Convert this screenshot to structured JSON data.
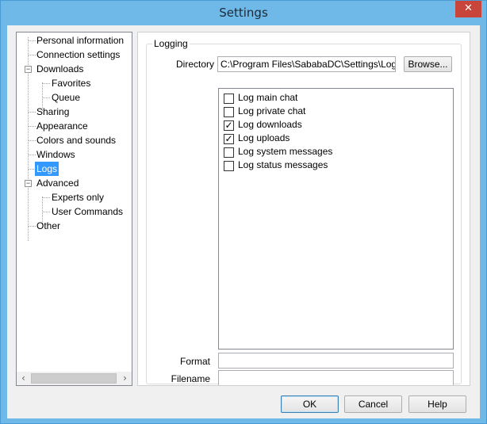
{
  "window": {
    "title": "Settings",
    "close_glyph": "✕"
  },
  "tree": {
    "items": [
      {
        "label": "Personal information"
      },
      {
        "label": "Connection settings"
      },
      {
        "label": "Downloads",
        "expander": "−"
      },
      {
        "label": "Favorites"
      },
      {
        "label": "Queue"
      },
      {
        "label": "Sharing"
      },
      {
        "label": "Appearance"
      },
      {
        "label": "Colors and sounds"
      },
      {
        "label": "Windows"
      },
      {
        "label": "Logs",
        "selected": true
      },
      {
        "label": "Advanced",
        "expander": "−"
      },
      {
        "label": "Experts only"
      },
      {
        "label": "User Commands"
      },
      {
        "label": "Other"
      }
    ],
    "scroll_left": "‹",
    "scroll_right": "›"
  },
  "logging": {
    "group_title": "Logging",
    "directory_label": "Directory",
    "directory_value": "C:\\Program Files\\SababaDC\\Settings\\Logs\\",
    "browse_label": "Browse...",
    "options": [
      {
        "label": "Log main chat",
        "checked": false
      },
      {
        "label": "Log private chat",
        "checked": false
      },
      {
        "label": "Log downloads",
        "checked": true
      },
      {
        "label": "Log uploads",
        "checked": true
      },
      {
        "label": "Log system messages",
        "checked": false
      },
      {
        "label": "Log status messages",
        "checked": false
      }
    ],
    "check_glyph": "✓",
    "format_label": "Format",
    "format_value": "",
    "filename_label": "Filename",
    "filename_value": ""
  },
  "footer": {
    "ok_label": "OK",
    "cancel_label": "Cancel",
    "help_label": "Help"
  }
}
